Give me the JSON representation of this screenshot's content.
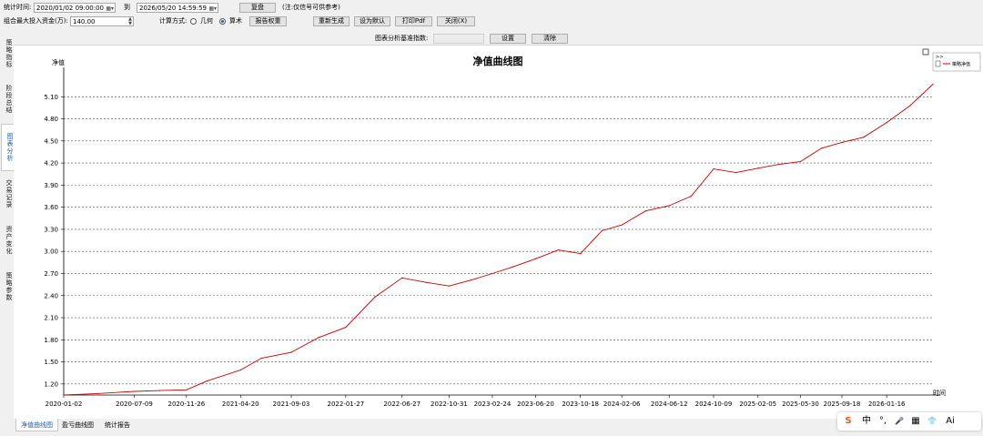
{
  "toolbar": {
    "stat_time_label": "统计时间:",
    "start_datetime": "2020/01/02 09:00:00",
    "to_label": "到",
    "end_datetime": "2026/05/20 14:59:59",
    "replay_button": "复盘",
    "note": "(注:仅信号可供参考)",
    "max_invest_label": "组合最大投入资金(万):",
    "max_invest_value": "140.00",
    "calc_method_label": "计算方式:",
    "calc_options": [
      "几何",
      "算术"
    ],
    "calc_selected": "算术",
    "report_weight_button": "报告权重",
    "regenerate_button": "重新生成",
    "set_default_button": "设为默认",
    "print_pdf_button": "打印Pdf",
    "close_button": "关闭(X)",
    "benchmark_label": "图表分析基准指数:",
    "benchmark_value": "",
    "settings_button": "设置",
    "clear_button": "清除"
  },
  "side_tabs": [
    "策略指标",
    "阶段总结",
    "图表分析",
    "交易记录",
    "资产变化",
    "策略参数"
  ],
  "side_tab_active": "图表分析",
  "bottom_tabs": [
    "净值曲线图",
    "盈亏曲线图",
    "统计报告"
  ],
  "bottom_tab_active": "净值曲线图",
  "legend_toggle": ">>",
  "ime_toolbar": {
    "brand": "S",
    "items": [
      "中",
      "°,",
      "🎤",
      "▦",
      "👕",
      "Ai"
    ]
  },
  "accent_color": "#1a5fb4",
  "series_color": "#cc0000",
  "chart_data": {
    "type": "line",
    "title": "净值曲线图",
    "ylabel": "净值",
    "xlabel": "时间",
    "ylim": [
      1.05,
      5.4
    ],
    "yticks": [
      "1.20",
      "1.50",
      "1.80",
      "2.10",
      "2.40",
      "2.70",
      "3.00",
      "3.30",
      "3.60",
      "3.90",
      "4.20",
      "4.50",
      "4.80",
      "5.10"
    ],
    "x_tick_labels": [
      "2020-01-02",
      "2020-07-09",
      "2020-11-26",
      "2021-04-20",
      "2021-09-03",
      "2022-01-27",
      "2022-06-27",
      "2022-10-31",
      "2023-02-24",
      "2023-06-20",
      "2023-10-18",
      "2024-02-06",
      "2024-06-12",
      "2024-10-09",
      "2025-02-05",
      "2025-05-30",
      "2025-09-18",
      "2026-01-16"
    ],
    "grid": true,
    "legend_position": "top-right",
    "series": [
      {
        "name": "策略净值",
        "x": [
          "2020-01-02",
          "2020-04-01",
          "2020-07-09",
          "2020-09-15",
          "2020-11-26",
          "2021-01-20",
          "2021-04-20",
          "2021-06-15",
          "2021-09-03",
          "2021-11-15",
          "2022-01-27",
          "2022-04-15",
          "2022-06-27",
          "2022-08-30",
          "2022-10-31",
          "2022-12-28",
          "2023-02-24",
          "2023-04-20",
          "2023-06-20",
          "2023-08-20",
          "2023-10-18",
          "2023-12-15",
          "2024-02-06",
          "2024-04-10",
          "2024-06-12",
          "2024-08-10",
          "2024-10-09",
          "2024-12-08",
          "2025-02-05",
          "2025-04-01",
          "2025-05-30",
          "2025-07-25",
          "2025-09-18",
          "2025-11-15",
          "2026-01-16",
          "2026-03-20",
          "2026-05-20"
        ],
        "values": [
          1.05,
          1.07,
          1.1,
          1.11,
          1.12,
          1.24,
          1.39,
          1.55,
          1.63,
          1.83,
          1.97,
          2.38,
          2.64,
          2.58,
          2.53,
          2.61,
          2.7,
          2.79,
          2.9,
          3.02,
          2.97,
          3.28,
          3.36,
          3.55,
          3.62,
          3.75,
          4.12,
          4.07,
          4.13,
          4.18,
          4.22,
          4.4,
          4.48,
          4.55,
          4.75,
          4.98,
          5.27
        ]
      }
    ]
  }
}
